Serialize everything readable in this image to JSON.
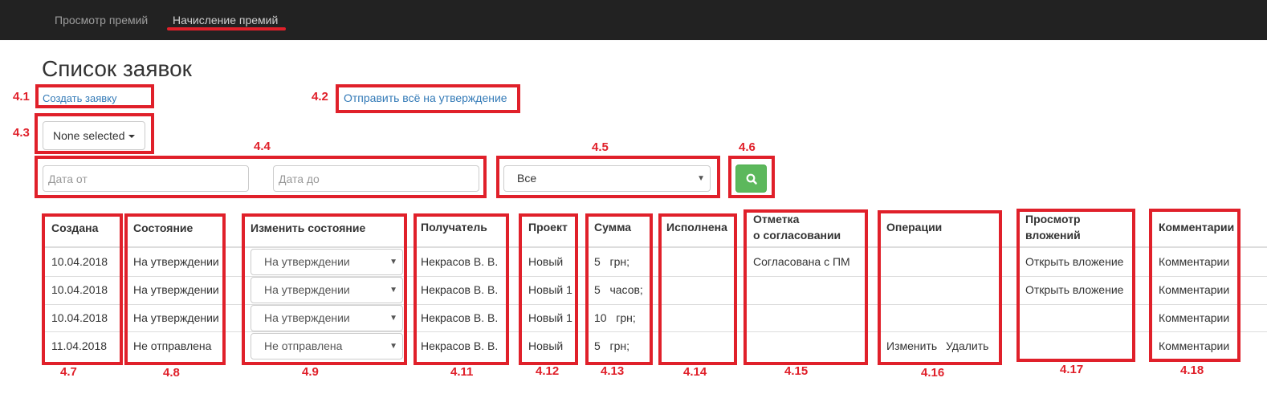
{
  "nav": {
    "items": [
      {
        "label": "Просмотр премий"
      },
      {
        "label": "Начисление премий"
      }
    ]
  },
  "page": {
    "title": "Список заявок",
    "create_link": "Создать заявку",
    "send_all_link": "Отправить всё на утверждение"
  },
  "filters": {
    "multiselect_label": "None selected",
    "date_from_placeholder": "Дата от",
    "date_to_placeholder": "Дата до",
    "status_value": "Все"
  },
  "table": {
    "headers": {
      "created": "Создана",
      "state": "Состояние",
      "change_state": "Изменить состояние",
      "recipient": "Получатель",
      "project": "Проект",
      "amount": "Сумма",
      "executed": "Исполнена",
      "approval_mark_line1": "Отметка",
      "approval_mark_line2": "о согласовании",
      "operations": "Операции",
      "attachments_line1": "Просмотр",
      "attachments_line2": "вложений",
      "comments": "Комментарии"
    },
    "rows": [
      {
        "created": "10.04.2018",
        "state": "На утверждении",
        "change_state": "На утверждении",
        "recipient": "Некрасов В. В.",
        "project": "Новый",
        "amount_value": "5",
        "amount_unit": "грн;",
        "executed": "",
        "approval": "Согласована с ПМ",
        "edit": "",
        "delete": "",
        "attachment": "Открыть вложение",
        "comments": "Комментарии"
      },
      {
        "created": "10.04.2018",
        "state": "На утверждении",
        "change_state": "На утверждении",
        "recipient": "Некрасов В. В.",
        "project": "Новый 1",
        "amount_value": "5",
        "amount_unit": "часов;",
        "executed": "",
        "approval": "",
        "edit": "",
        "delete": "",
        "attachment": "Открыть вложение",
        "comments": "Комментарии"
      },
      {
        "created": "10.04.2018",
        "state": "На утверждении",
        "change_state": "На утверждении",
        "recipient": "Некрасов В. В.",
        "project": "Новый 1",
        "amount_value": "10",
        "amount_unit": "грн;",
        "executed": "",
        "approval": "",
        "edit": "",
        "delete": "",
        "attachment": "",
        "comments": "Комментарии"
      },
      {
        "created": "11.04.2018",
        "state": "Не отправлена",
        "change_state": "Не отправлена",
        "recipient": "Некрасов В. В.",
        "project": "Новый",
        "amount_value": "5",
        "amount_unit": "грн;",
        "executed": "",
        "approval": "",
        "edit": "Изменить",
        "delete": "Удалить",
        "attachment": "",
        "comments": "Комментарии"
      }
    ]
  },
  "annotations": {
    "labels": [
      "4.1",
      "4.2",
      "4.3",
      "4.4",
      "4.5",
      "4.6",
      "4.7",
      "4.8",
      "4.9",
      "4.11",
      "4.12",
      "4.13",
      "4.14",
      "4.15",
      "4.16",
      "4.17",
      "4.18"
    ],
    "color": "#e0202a"
  },
  "colors": {
    "navbar_bg": "#222222",
    "nav_text": "#9d9d9d",
    "nav_active_text": "#d0d0d0",
    "link": "#337ab7",
    "search_button": "#5cb85c",
    "annotation_red": "#e0202a"
  },
  "icons": {
    "search": "search-icon",
    "caret": "caret-down-icon",
    "select_arrow": "select-arrow-icon"
  }
}
